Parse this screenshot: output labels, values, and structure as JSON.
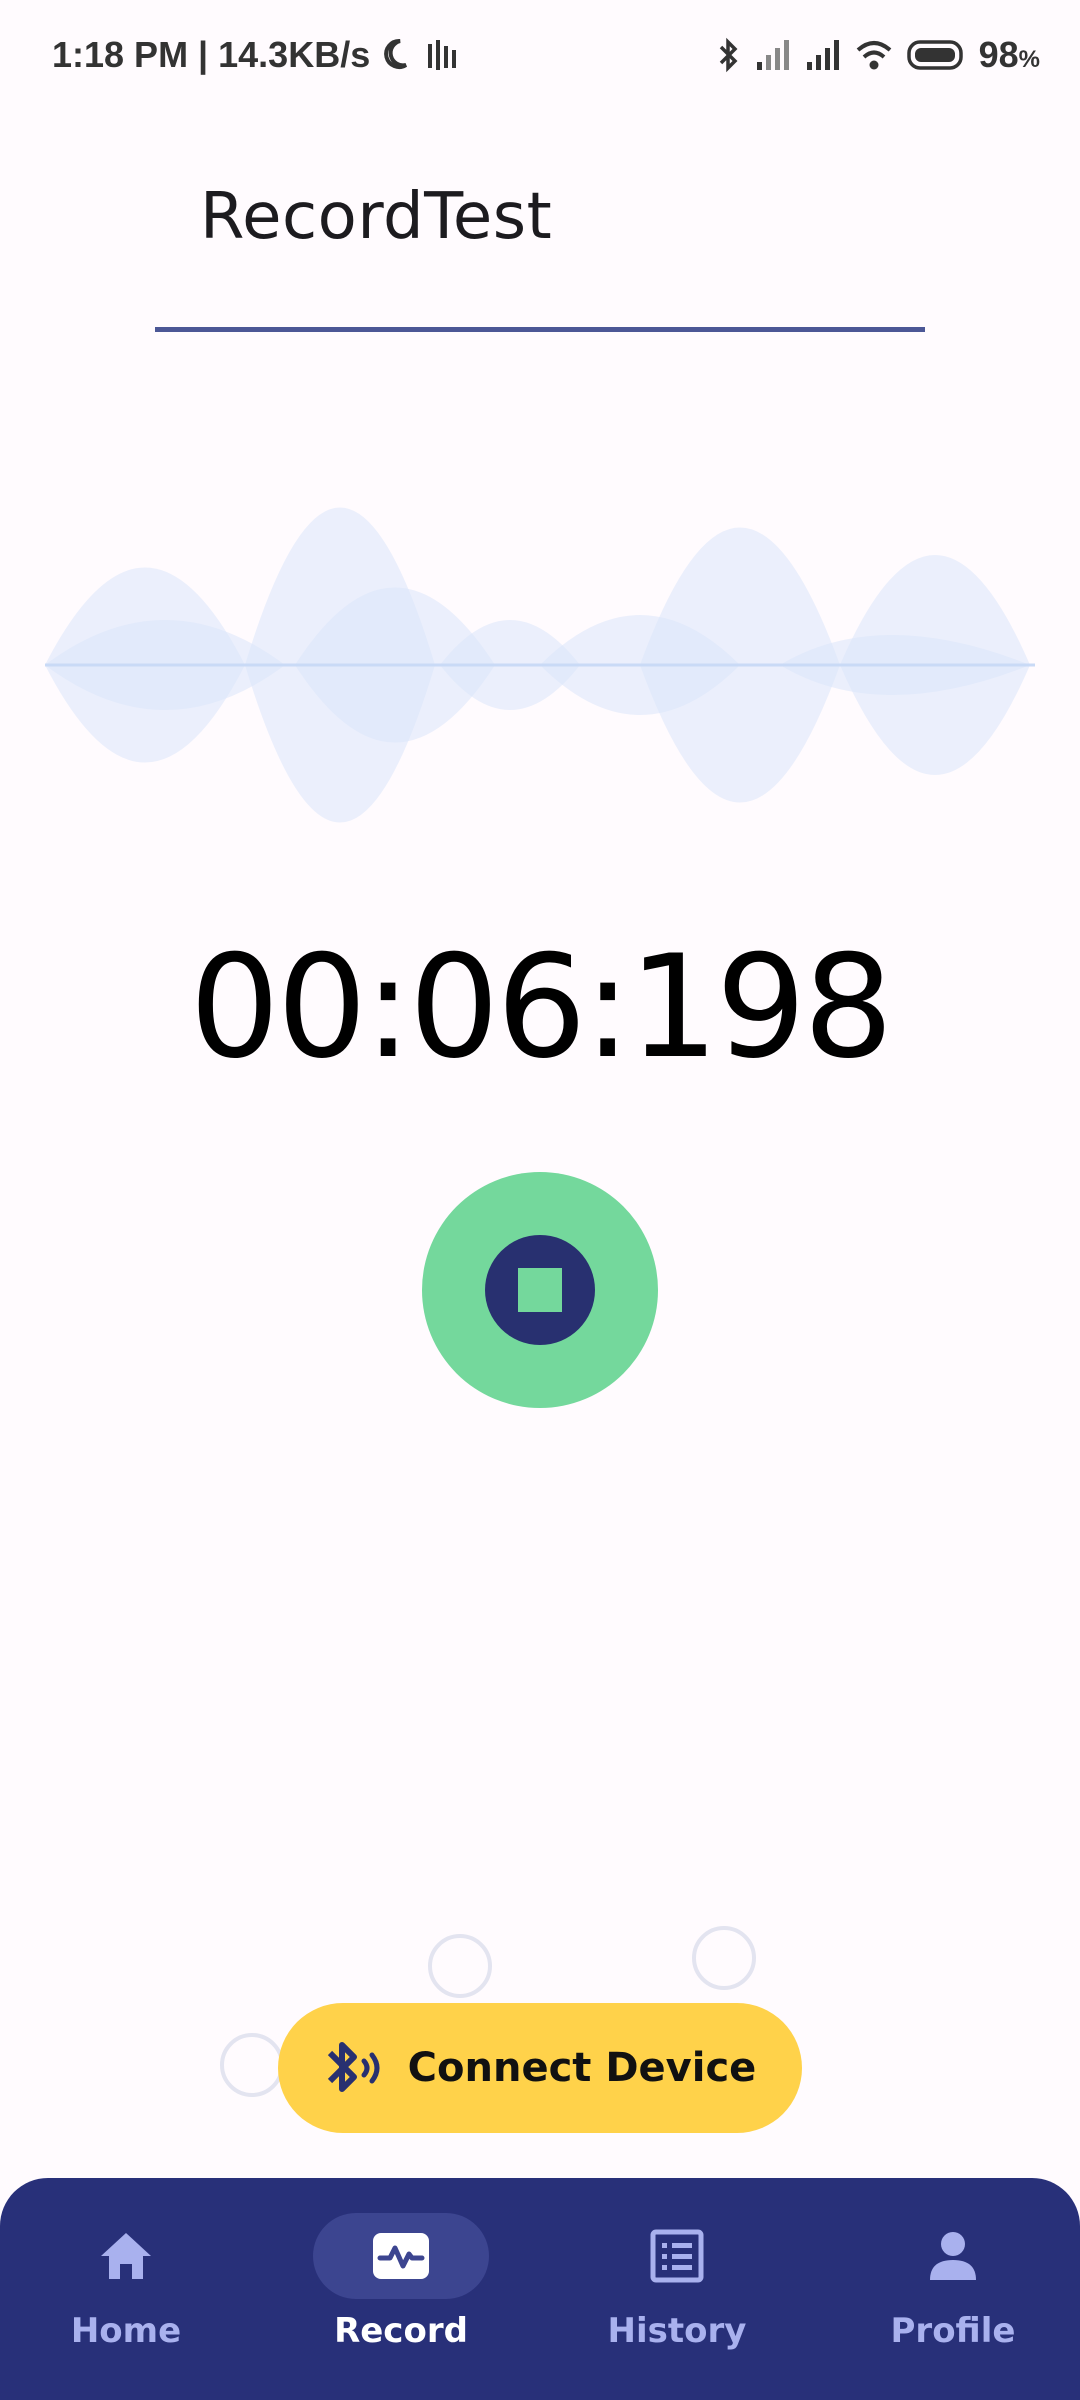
{
  "status_bar": {
    "time_speed": "1:18 PM | 14.3KB/s",
    "battery": "98",
    "battery_unit": "%",
    "icons": [
      "moon-icon",
      "sound-bars-icon",
      "bluetooth-icon",
      "signal-icon",
      "signal-icon",
      "wifi-icon",
      "battery-icon"
    ]
  },
  "app": {
    "title": "RecordTest"
  },
  "recorder": {
    "timer": "00:06:198",
    "record_button_icon": "stop-icon"
  },
  "connect": {
    "label": "Connect Device",
    "icon": "bluetooth-audio-icon"
  },
  "nav": {
    "items": [
      {
        "label": "Home",
        "icon": "home-icon",
        "active": false
      },
      {
        "label": "Record",
        "icon": "waveform-icon",
        "active": true
      },
      {
        "label": "History",
        "icon": "list-icon",
        "active": false
      },
      {
        "label": "Profile",
        "icon": "person-icon",
        "active": false
      }
    ]
  },
  "colors": {
    "background": "#fffbfe",
    "accent": "#283079",
    "record_green": "#74d89c",
    "connect_yellow": "#ffd24a",
    "wave": "#dbe6f9"
  }
}
